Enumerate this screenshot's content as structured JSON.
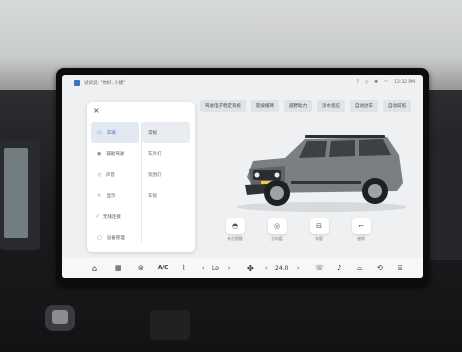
{
  "status": {
    "voice_hint": "试试说: \"你好, 小捷\"",
    "time": "13:32 PM"
  },
  "tabs": [
    "驾驶电子稳定系统",
    "陡坡缓降",
    "越野助力",
    "涉水感应",
    "自动驻车",
    "自动前照"
  ],
  "menu": {
    "close": "×",
    "items": [
      {
        "label": "车辆",
        "icon": "car-icon",
        "glyph": "▭",
        "active": true
      },
      {
        "label": "辅助驾驶",
        "icon": "steering-icon",
        "glyph": "◉",
        "active": false
      },
      {
        "label": "声音",
        "icon": "sound-icon",
        "glyph": "◁",
        "active": false
      },
      {
        "label": "显示",
        "icon": "display-icon",
        "glyph": "☼",
        "active": false
      },
      {
        "label": "无线连接",
        "icon": "wireless-icon",
        "glyph": "⁄",
        "active": false
      },
      {
        "label": "设备管理",
        "icon": "device-icon",
        "glyph": "▢",
        "active": false
      }
    ],
    "sub_items": [
      {
        "label": "常规",
        "active": true
      },
      {
        "label": "车外灯",
        "active": false
      },
      {
        "label": "氛围灯",
        "active": false
      },
      {
        "label": "车锁",
        "active": false
      }
    ]
  },
  "controls": [
    {
      "label": "外后视镜",
      "glyph": "◓"
    },
    {
      "label": "方向盘",
      "glyph": "◎"
    },
    {
      "label": "车窗",
      "glyph": "⊟"
    },
    {
      "label": "座椅",
      "glyph": "⌐"
    }
  ],
  "dock": {
    "home": "⌂",
    "apps": "▦",
    "fan_mode": "⊜",
    "ac": "A/C",
    "seat_heat": "⌇",
    "left_temp": "Lo",
    "fan": "✤",
    "right_temp": "24.0",
    "phone": "☏",
    "media": "♪",
    "defrost_front": "⌓",
    "recirc": "⟲",
    "defrost_rear": "⌸"
  }
}
